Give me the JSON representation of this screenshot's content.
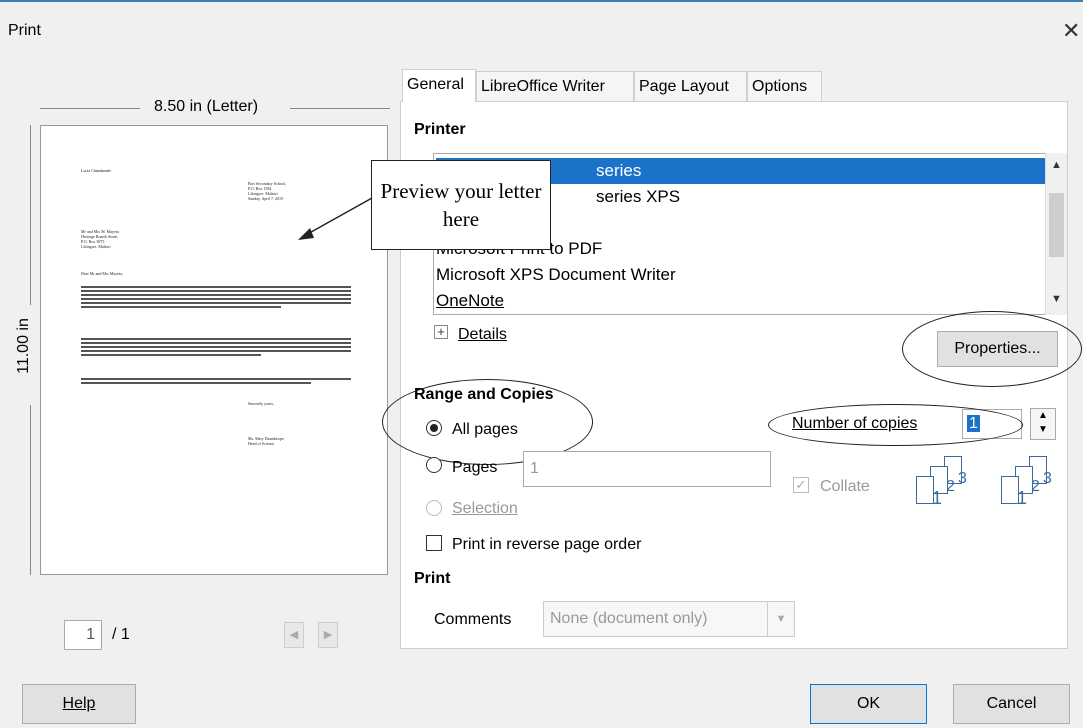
{
  "window": {
    "title": "Print",
    "close_glyph": "✕"
  },
  "preview": {
    "width_label": "8.50 in (Letter)",
    "height_label": "11.00 in",
    "letter": {
      "sender": "Lucia Chandamale",
      "school": [
        "Bivi Secondary School,",
        "P.O. Box 1584",
        "Lilongwe, Malawi",
        "Sunday, April 7, 2019"
      ],
      "recipient": [
        "Mr and Mrs M. Mayeta",
        "Heritage Boards Street,",
        "P.O. Box 3875",
        "Lilongwe, Malawi"
      ],
      "greeting": "Dear Mr and Mrs Mayeta,",
      "closing": "Sincerely yours,",
      "signature": [
        "Ms. Mary Dzanduwpe",
        "Head of Science"
      ]
    },
    "page_current": "1",
    "page_total": "/ 1"
  },
  "tabs": [
    "General",
    "LibreOffice Writer",
    "Page Layout",
    "Options"
  ],
  "printer": {
    "header": "Printer",
    "items": [
      "series",
      "series XPS",
      "",
      "Microsoft Print to PDF",
      "Microsoft XPS Document Writer",
      "OneNote"
    ],
    "details_label": "Details",
    "properties_label": "Properties..."
  },
  "range": {
    "header": "Range and Copies",
    "all_pages": "All pages",
    "pages": "Pages",
    "pages_value": "1",
    "selection": "Selection",
    "reverse": "Print in reverse page order",
    "copies_label": "Number of copies",
    "copies_value": "1",
    "collate": "Collate"
  },
  "print_section": {
    "header": "Print",
    "comments_label": "Comments",
    "comments_value": "None (document only)"
  },
  "annotation": {
    "callout": "Preview your letter here"
  },
  "buttons": {
    "help": "Help",
    "ok": "OK",
    "cancel": "Cancel"
  },
  "colors": {
    "accent": "#1a73c8",
    "window_bg": "#f0f0f0"
  }
}
